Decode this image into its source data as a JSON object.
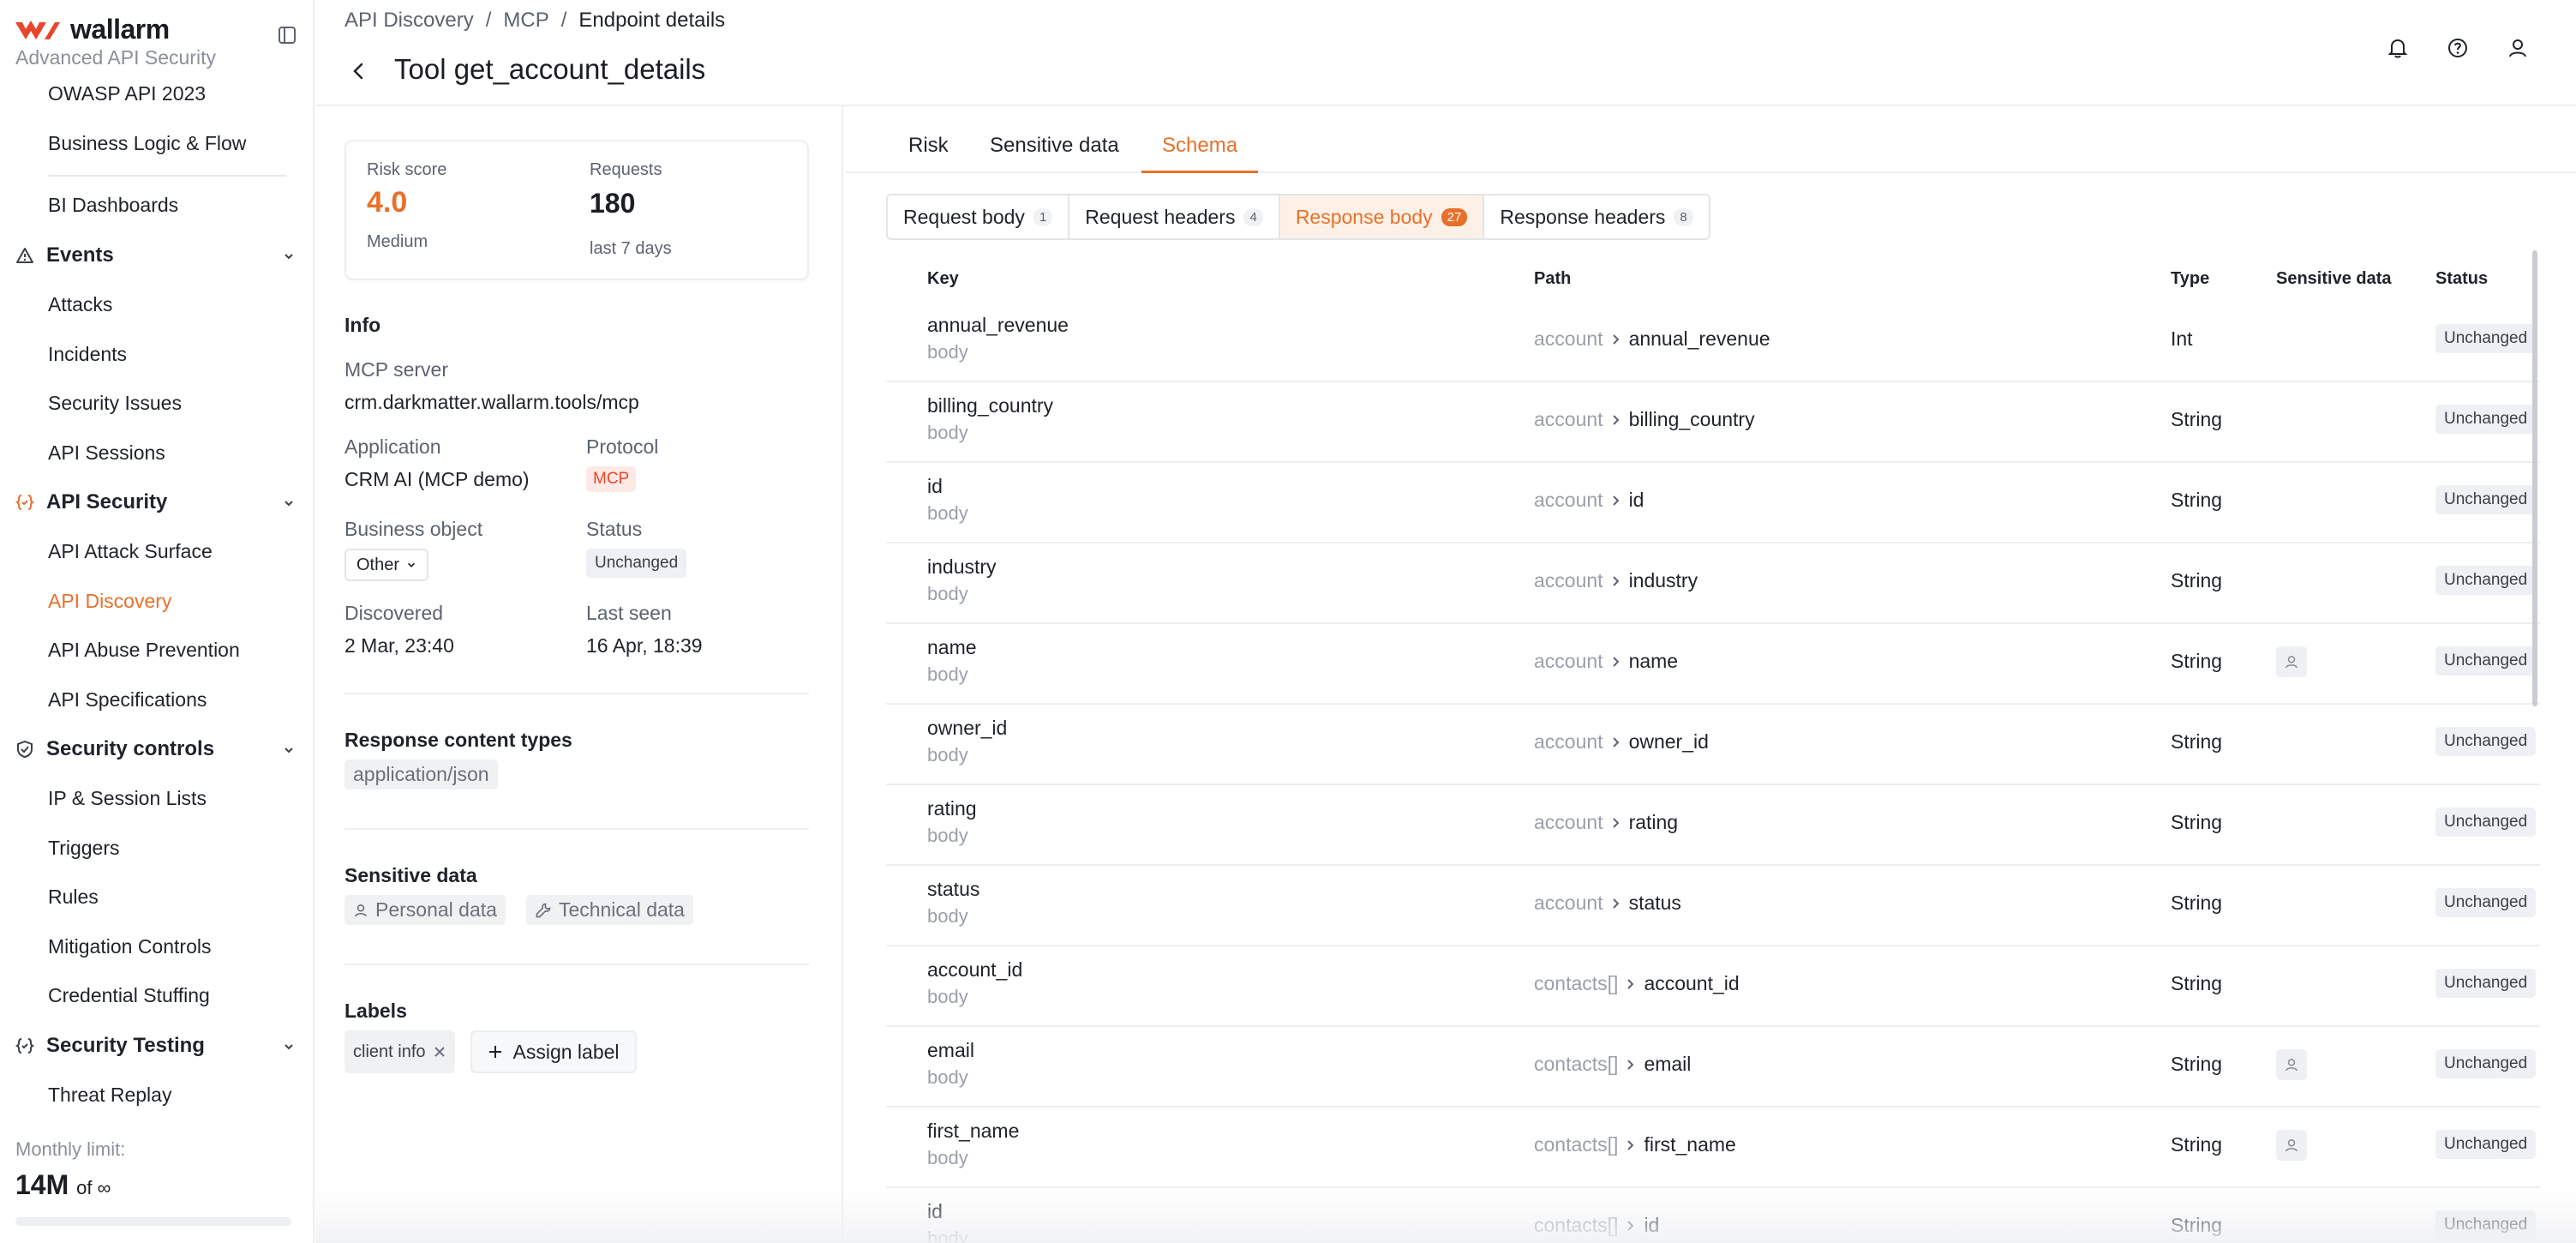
{
  "brand": {
    "name": "wallarm",
    "subtitle": "Advanced API Security",
    "accent": "#e8702a"
  },
  "sidebar": {
    "items": [
      {
        "label": "OWASP API 2023"
      },
      {
        "label": "Business Logic & Flow"
      },
      {
        "label": "BI Dashboards"
      },
      {
        "label": "Events",
        "group": true
      },
      {
        "label": "Attacks"
      },
      {
        "label": "Incidents"
      },
      {
        "label": "Security Issues"
      },
      {
        "label": "API Sessions"
      },
      {
        "label": "API Security",
        "group": true
      },
      {
        "label": "API Attack Surface"
      },
      {
        "label": "API Discovery",
        "active": true
      },
      {
        "label": "API Abuse Prevention"
      },
      {
        "label": "API Specifications"
      },
      {
        "label": "Security controls",
        "group": true
      },
      {
        "label": "IP & Session Lists"
      },
      {
        "label": "Triggers"
      },
      {
        "label": "Rules"
      },
      {
        "label": "Mitigation Controls"
      },
      {
        "label": "Credential Stuffing"
      },
      {
        "label": "Security Testing",
        "group": true
      },
      {
        "label": "Threat Replay"
      }
    ],
    "limit": {
      "label": "Monthly limit:",
      "value": "14M",
      "of": "of ∞"
    }
  },
  "breadcrumb": [
    "API Discovery",
    "MCP",
    "Endpoint details"
  ],
  "page": {
    "title": "Tool get_account_details"
  },
  "stats": {
    "risk_label": "Risk score",
    "risk_value": "4.0",
    "risk_level": "Medium",
    "requests_label": "Requests",
    "requests_value": "180",
    "requests_period": "last 7 days"
  },
  "info": {
    "title": "Info",
    "mcp_server_label": "MCP server",
    "mcp_server": "crm.darkmatter.wallarm.tools/mcp",
    "application_label": "Application",
    "application": "CRM AI (MCP demo)",
    "protocol_label": "Protocol",
    "protocol": "MCP",
    "business_object_label": "Business object",
    "business_object": "Other",
    "status_label": "Status",
    "status": "Unchanged",
    "discovered_label": "Discovered",
    "discovered": "2 Mar, 23:40",
    "last_seen_label": "Last seen",
    "last_seen": "16 Apr, 18:39"
  },
  "content_types": {
    "title": "Response content types",
    "items": [
      "application/json"
    ]
  },
  "sensitive": {
    "title": "Sensitive data",
    "items": [
      "Personal data",
      "Technical data"
    ]
  },
  "labels": {
    "title": "Labels",
    "items": [
      "client info"
    ],
    "assign": "Assign label"
  },
  "tabs": [
    "Risk",
    "Sensitive data",
    "Schema"
  ],
  "subtabs": [
    {
      "label": "Request body",
      "count": "1"
    },
    {
      "label": "Request headers",
      "count": "4"
    },
    {
      "label": "Response body",
      "count": "27"
    },
    {
      "label": "Response headers",
      "count": "8"
    }
  ],
  "table": {
    "headers": [
      "Key",
      "Path",
      "Type",
      "Sensitive data",
      "Status"
    ],
    "rows": [
      {
        "key": "annual_revenue",
        "src": "body",
        "path_parent": "account",
        "path_key": "annual_revenue",
        "type": "Int",
        "sensitive": false,
        "status": "Unchanged"
      },
      {
        "key": "billing_country",
        "src": "body",
        "path_parent": "account",
        "path_key": "billing_country",
        "type": "String",
        "sensitive": false,
        "status": "Unchanged"
      },
      {
        "key": "id",
        "src": "body",
        "path_parent": "account",
        "path_key": "id",
        "type": "String",
        "sensitive": false,
        "status": "Unchanged"
      },
      {
        "key": "industry",
        "src": "body",
        "path_parent": "account",
        "path_key": "industry",
        "type": "String",
        "sensitive": false,
        "status": "Unchanged"
      },
      {
        "key": "name",
        "src": "body",
        "path_parent": "account",
        "path_key": "name",
        "type": "String",
        "sensitive": true,
        "status": "Unchanged"
      },
      {
        "key": "owner_id",
        "src": "body",
        "path_parent": "account",
        "path_key": "owner_id",
        "type": "String",
        "sensitive": false,
        "status": "Unchanged"
      },
      {
        "key": "rating",
        "src": "body",
        "path_parent": "account",
        "path_key": "rating",
        "type": "String",
        "sensitive": false,
        "status": "Unchanged"
      },
      {
        "key": "status",
        "src": "body",
        "path_parent": "account",
        "path_key": "status",
        "type": "String",
        "sensitive": false,
        "status": "Unchanged"
      },
      {
        "key": "account_id",
        "src": "body",
        "path_parent": "contacts[]",
        "path_key": "account_id",
        "type": "String",
        "sensitive": false,
        "status": "Unchanged"
      },
      {
        "key": "email",
        "src": "body",
        "path_parent": "contacts[]",
        "path_key": "email",
        "type": "String",
        "sensitive": true,
        "status": "Unchanged"
      },
      {
        "key": "first_name",
        "src": "body",
        "path_parent": "contacts[]",
        "path_key": "first_name",
        "type": "String",
        "sensitive": true,
        "status": "Unchanged"
      },
      {
        "key": "id",
        "src": "body",
        "path_parent": "contacts[]",
        "path_key": "id",
        "type": "String",
        "sensitive": false,
        "status": "Unchanged"
      }
    ]
  }
}
